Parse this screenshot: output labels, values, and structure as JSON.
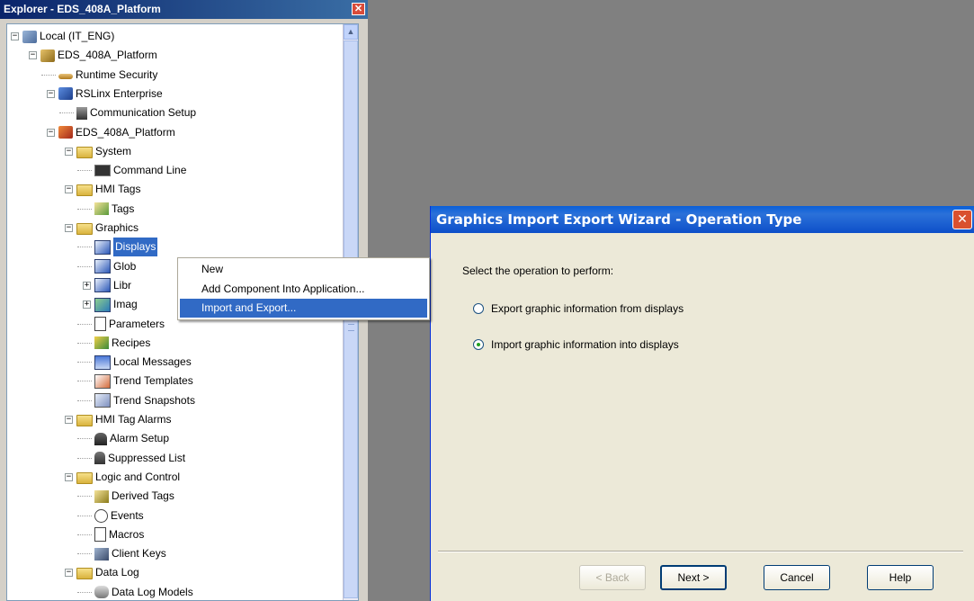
{
  "explorer": {
    "title": "Explorer - EDS_408A_Platform",
    "close": "✕",
    "tree": [
      {
        "label": "Local (IT_ENG)",
        "level": 0,
        "exp": "−",
        "icon": "local-computer-icon"
      },
      {
        "label": "EDS_408A_Platform",
        "level": 1,
        "exp": "−",
        "icon": "application-icon"
      },
      {
        "label": "Runtime Security",
        "level": 2,
        "exp": "",
        "icon": "key-icon"
      },
      {
        "label": "RSLinx Enterprise",
        "level": 2,
        "exp": "−",
        "icon": "network-icon"
      },
      {
        "label": "Communication Setup",
        "level": 3,
        "exp": "",
        "icon": "communication-icon"
      },
      {
        "label": "EDS_408A_Platform",
        "level": 2,
        "exp": "−",
        "icon": "hmi-server-icon"
      },
      {
        "label": "System",
        "level": 3,
        "exp": "−",
        "icon": "folder-icon"
      },
      {
        "label": "Command Line",
        "level": 4,
        "exp": "",
        "icon": "command-line-icon"
      },
      {
        "label": "HMI Tags",
        "level": 3,
        "exp": "−",
        "icon": "folder-icon"
      },
      {
        "label": "Tags",
        "level": 4,
        "exp": "",
        "icon": "tags-icon"
      },
      {
        "label": "Graphics",
        "level": 3,
        "exp": "−",
        "icon": "folder-icon"
      },
      {
        "label": "Displays",
        "level": 4,
        "exp": "",
        "icon": "displays-icon",
        "selected": true
      },
      {
        "label": "Glob",
        "level": 4,
        "exp": "",
        "icon": "displays-icon"
      },
      {
        "label": "Libr",
        "level": 4,
        "exp": "+",
        "icon": "displays-icon"
      },
      {
        "label": "Imag",
        "level": 4,
        "exp": "+",
        "icon": "images-icon"
      },
      {
        "label": "Parameters",
        "level": 4,
        "exp": "",
        "icon": "parameters-icon"
      },
      {
        "label": "Recipes",
        "level": 4,
        "exp": "",
        "icon": "recipes-icon"
      },
      {
        "label": "Local Messages",
        "level": 4,
        "exp": "",
        "icon": "local-messages-icon"
      },
      {
        "label": "Trend Templates",
        "level": 4,
        "exp": "",
        "icon": "trend-templates-icon"
      },
      {
        "label": "Trend Snapshots",
        "level": 4,
        "exp": "",
        "icon": "trend-snapshots-icon"
      },
      {
        "label": "HMI Tag Alarms",
        "level": 3,
        "exp": "−",
        "icon": "folder-icon"
      },
      {
        "label": "Alarm Setup",
        "level": 4,
        "exp": "",
        "icon": "alarm-setup-icon"
      },
      {
        "label": "Suppressed List",
        "level": 4,
        "exp": "",
        "icon": "suppressed-list-icon"
      },
      {
        "label": "Logic and Control",
        "level": 3,
        "exp": "−",
        "icon": "folder-icon"
      },
      {
        "label": "Derived Tags",
        "level": 4,
        "exp": "",
        "icon": "derived-tags-icon"
      },
      {
        "label": "Events",
        "level": 4,
        "exp": "",
        "icon": "events-icon"
      },
      {
        "label": "Macros",
        "level": 4,
        "exp": "",
        "icon": "macros-icon"
      },
      {
        "label": "Client Keys",
        "level": 4,
        "exp": "",
        "icon": "client-keys-icon"
      },
      {
        "label": "Data Log",
        "level": 3,
        "exp": "−",
        "icon": "folder-icon"
      },
      {
        "label": "Data Log Models",
        "level": 4,
        "exp": "",
        "icon": "data-log-models-icon"
      }
    ]
  },
  "context_menu": {
    "items": [
      "New",
      "Add Component Into Application...",
      "Import and Export..."
    ],
    "highlighted": 2
  },
  "wizard": {
    "title": "Graphics Import Export Wizard - Operation Type",
    "close": "✕",
    "prompt": "Select the operation to perform:",
    "options": [
      {
        "label": "Export graphic information from displays",
        "checked": false
      },
      {
        "label": "Import graphic information into displays",
        "checked": true
      }
    ],
    "buttons": {
      "back": "< Back",
      "next": "Next >",
      "cancel": "Cancel",
      "help": "Help"
    }
  }
}
